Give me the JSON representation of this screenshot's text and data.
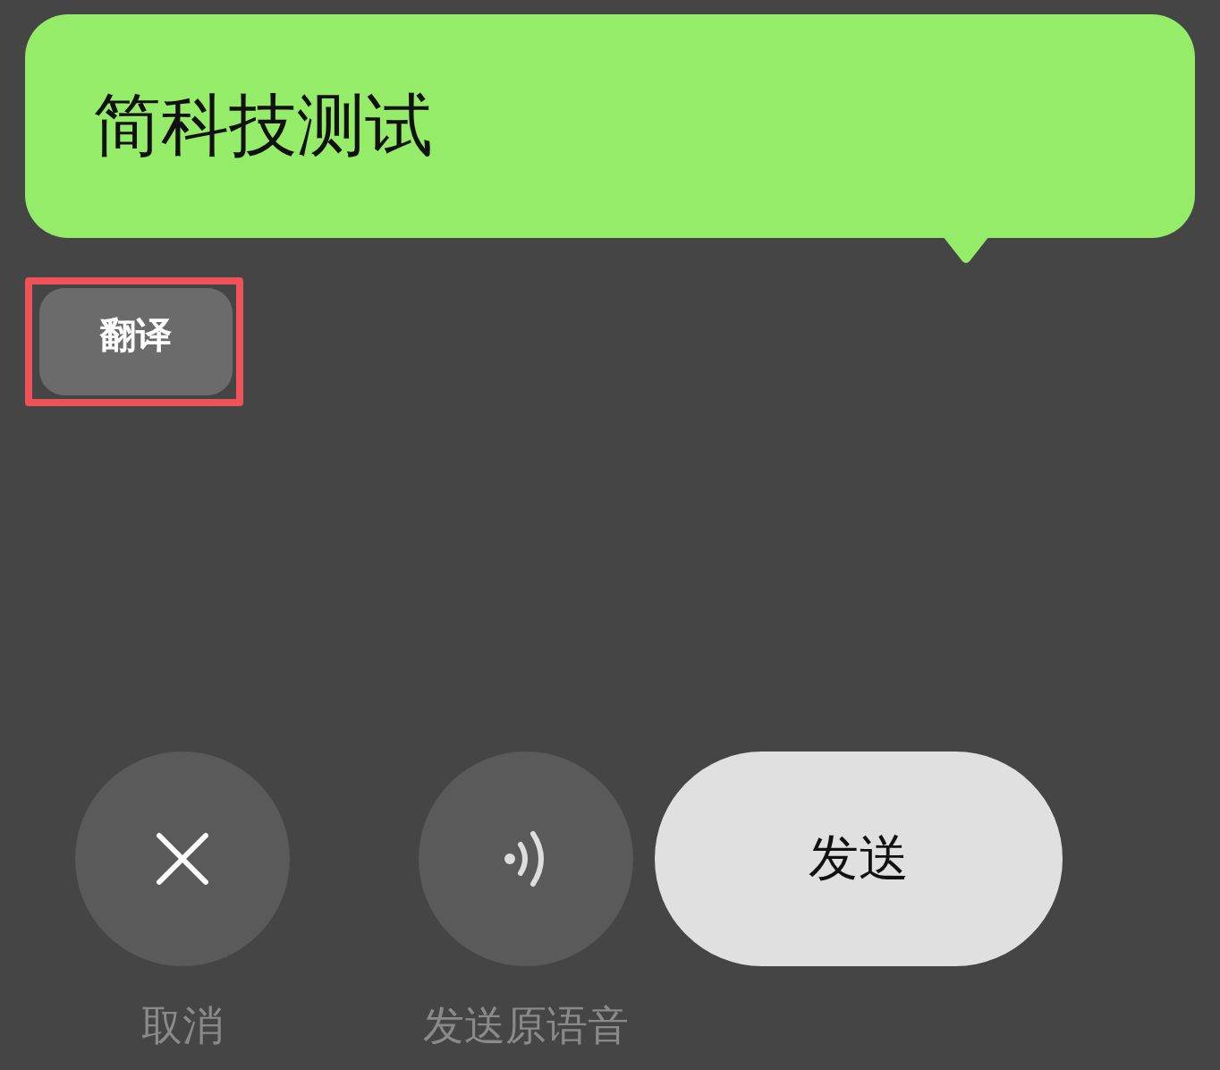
{
  "message_bubble": {
    "text": "简科技测试"
  },
  "translate_button": {
    "label": "翻译",
    "highlighted": true
  },
  "actions": [
    {
      "kind": "cancel",
      "label": "取消"
    },
    {
      "kind": "voice",
      "label": "发送原语音"
    },
    {
      "kind": "send",
      "label": "发送"
    }
  ]
}
